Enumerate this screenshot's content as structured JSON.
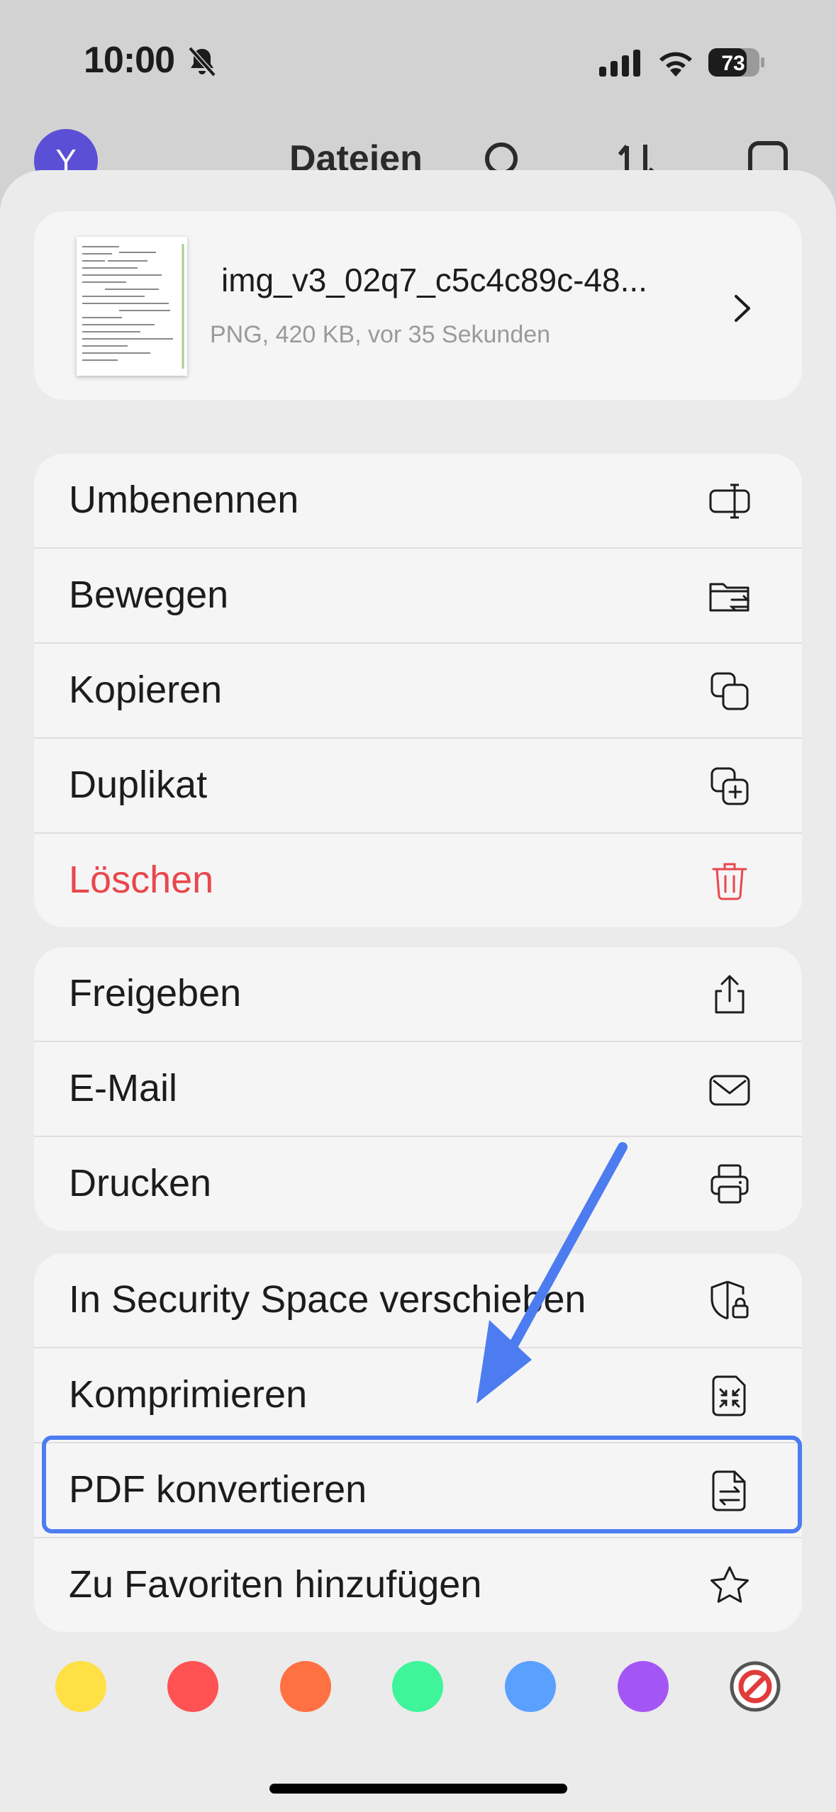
{
  "status_bar": {
    "time": "10:00",
    "battery_level": "73"
  },
  "background_header": {
    "avatar_letter": "Y",
    "title": "Dateien"
  },
  "file": {
    "name": "img_v3_02q7_c5c4c89c-48...",
    "meta": "PNG, 420 KB, vor 35 Sekunden"
  },
  "menu_groups": [
    {
      "items": [
        {
          "label": "Umbenennen",
          "icon": "rename-icon"
        },
        {
          "label": "Bewegen",
          "icon": "move-folder-icon"
        },
        {
          "label": "Kopieren",
          "icon": "copy-icon"
        },
        {
          "label": "Duplikat",
          "icon": "duplicate-icon"
        },
        {
          "label": "Löschen",
          "icon": "trash-icon",
          "color": "#e8474c"
        }
      ]
    },
    {
      "items": [
        {
          "label": "Freigeben",
          "icon": "share-icon"
        },
        {
          "label": "E-Mail",
          "icon": "mail-icon"
        },
        {
          "label": "Drucken",
          "icon": "printer-icon"
        }
      ]
    },
    {
      "items": [
        {
          "label": "In Security Space verschieben",
          "icon": "shield-lock-icon"
        },
        {
          "label": "Komprimieren",
          "icon": "compress-icon"
        },
        {
          "label": "PDF konvertieren",
          "icon": "convert-document-icon",
          "highlighted": true
        },
        {
          "label": "Zu Favoriten hinzufügen",
          "icon": "star-icon"
        }
      ]
    }
  ],
  "color_tags": [
    {
      "name": "yellow",
      "color": "#ffe045"
    },
    {
      "name": "red",
      "color": "#ff5252"
    },
    {
      "name": "orange",
      "color": "#ff7043"
    },
    {
      "name": "green",
      "color": "#3ef59a"
    },
    {
      "name": "blue",
      "color": "#5aa0ff"
    },
    {
      "name": "purple",
      "color": "#a456f5"
    },
    {
      "name": "none",
      "color": "#e23b3b"
    }
  ],
  "colors": {
    "accent_highlight": "#4d7cf0",
    "danger": "#e8474c"
  }
}
